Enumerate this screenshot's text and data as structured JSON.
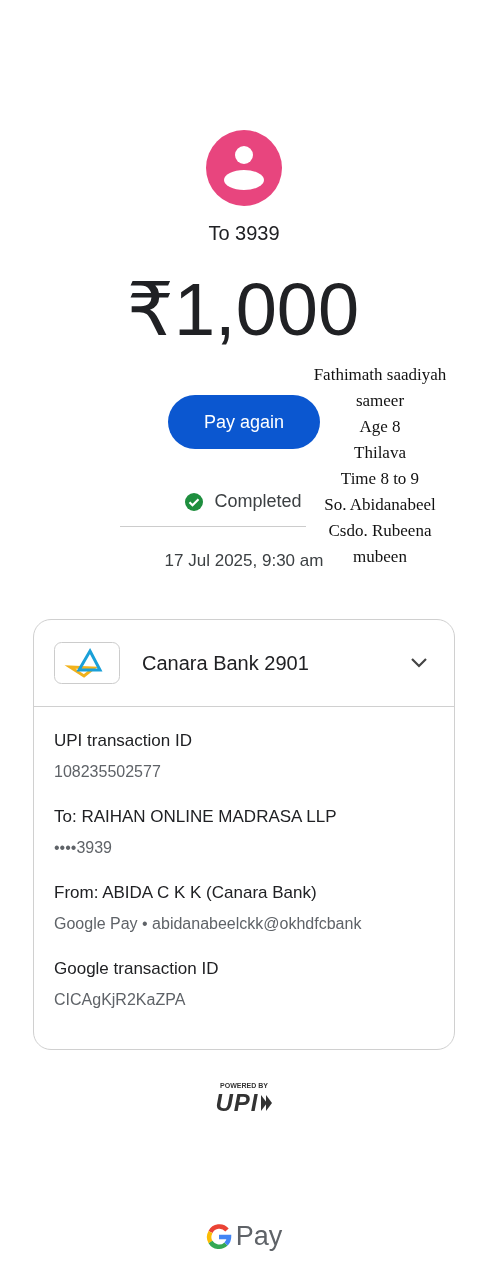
{
  "recipient": {
    "label": "To 3939"
  },
  "amount": "₹1,000",
  "pay_again_button": "Pay again",
  "status": {
    "completed": true,
    "label": "Completed"
  },
  "date": "17 Jul 2025, 9:30 am",
  "note": [
    "Fathimath saadiyah",
    "sameer",
    "Age 8",
    "Thilava",
    "Time 8 to 9",
    "So. Abidanabeel",
    "Csdo. Rubeena",
    "mubeen"
  ],
  "account": {
    "name": "Canara Bank 2901",
    "expanded": true
  },
  "details": [
    {
      "label": "UPI transaction ID",
      "value": "108235502577"
    },
    {
      "label": "To: RAIHAN ONLINE MADRASA LLP",
      "value": "••••3939"
    },
    {
      "label": "From: ABIDA C K K (Canara Bank)",
      "value": "Google Pay • abidanabeelckk@okhdfcbank"
    },
    {
      "label": "Google transaction ID",
      "value": "CICAgKjR2KaZPA"
    }
  ],
  "footer": {
    "powered_by": "POWERED BY",
    "upi": "UPI",
    "brand": "Pay"
  }
}
